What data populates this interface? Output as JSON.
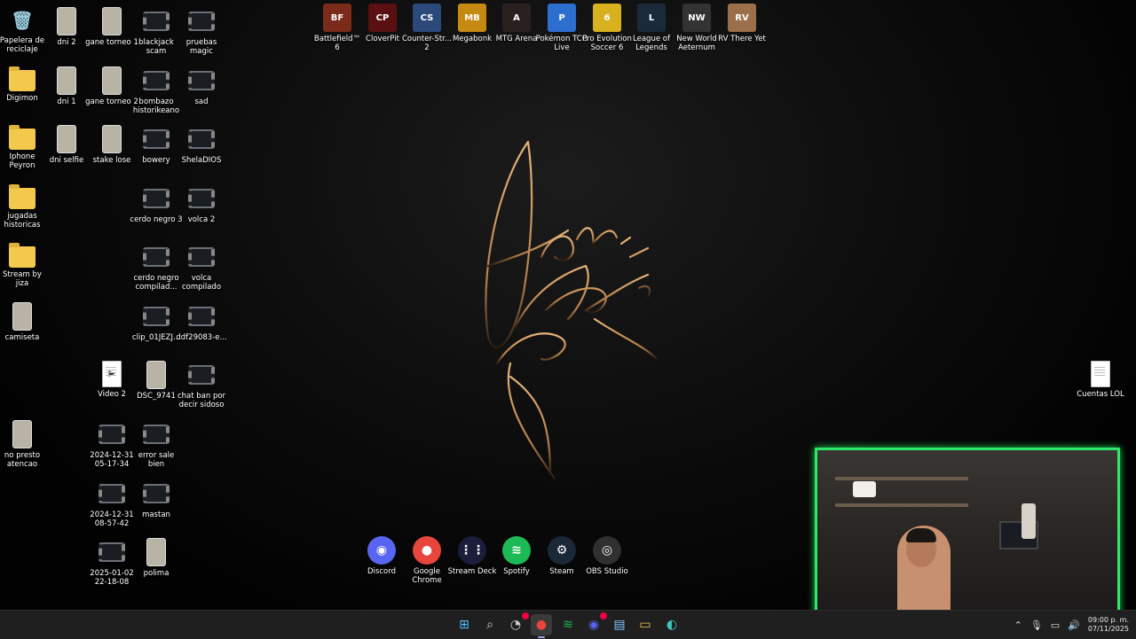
{
  "desktop": {
    "icons": [
      {
        "label": "Papelera de reciclaje",
        "icon": "recycle-bin-icon"
      },
      {
        "label": "dni 2",
        "icon": "photo-icon"
      },
      {
        "label": "gane torneo 1",
        "icon": "photo-icon"
      },
      {
        "label": "blackjack scam",
        "icon": "video-file-icon"
      },
      {
        "label": "pruebas magic",
        "icon": "video-file-icon"
      },
      {
        "label": "Digimon",
        "icon": "folder-icon"
      },
      {
        "label": "dni 1",
        "icon": "photo-icon"
      },
      {
        "label": "gane torneo 2",
        "icon": "photo-icon"
      },
      {
        "label": "bombazo historikeano",
        "icon": "video-file-icon"
      },
      {
        "label": "sad",
        "icon": "video-file-icon"
      },
      {
        "label": "Iphone Peyron",
        "icon": "folder-icon"
      },
      {
        "label": "dni selfie",
        "icon": "photo-icon"
      },
      {
        "label": "stake lose",
        "icon": "photo-icon"
      },
      {
        "label": "bowery",
        "icon": "video-file-icon"
      },
      {
        "label": "ShelaDIOS",
        "icon": "video-file-icon"
      },
      {
        "label": "jugadas historicas",
        "icon": "folder-icon"
      },
      {
        "label": "cerdo negro 3",
        "icon": "video-file-icon"
      },
      {
        "label": "volca 2",
        "icon": "video-file-icon"
      },
      {
        "label": "Stream by jiza",
        "icon": "folder-icon"
      },
      {
        "label": "cerdo negro compilad...",
        "icon": "video-file-icon"
      },
      {
        "label": "volca compilado",
        "icon": "video-file-icon"
      },
      {
        "label": "camiseta",
        "icon": "photo-icon"
      },
      {
        "label": "clip_01JEZJ...",
        "icon": "video-file-icon"
      },
      {
        "label": "ddf29083-e...",
        "icon": "video-file-icon"
      },
      {
        "label": "Video 2",
        "icon": "video-player-icon"
      },
      {
        "label": "DSC_9741",
        "icon": "photo-icon"
      },
      {
        "label": "chat ban por decir sidoso",
        "icon": "video-file-icon"
      },
      {
        "label": "no presto atencao",
        "icon": "photo-icon"
      },
      {
        "label": "2024-12-31 05-17-34",
        "icon": "video-file-icon"
      },
      {
        "label": "error sale bien",
        "icon": "video-file-icon"
      },
      {
        "label": "2024-12-31 08-57-42",
        "icon": "video-file-icon"
      },
      {
        "label": "mastan",
        "icon": "video-file-icon"
      },
      {
        "label": "2025-01-02 22-18-08",
        "icon": "video-file-icon"
      },
      {
        "label": "polima",
        "icon": "photo-icon"
      },
      {
        "label": "Cuentas LOL",
        "icon": "text-file-icon"
      }
    ],
    "apps": [
      {
        "label": "Battlefield™ 6",
        "color": "#7a2b1a",
        "glyph": "BF"
      },
      {
        "label": "CloverPit",
        "color": "#5a1010",
        "glyph": "CP"
      },
      {
        "label": "Counter-Str... 2",
        "color": "#2b4a7a",
        "glyph": "CS"
      },
      {
        "label": "Megabonk",
        "color": "#c68a12",
        "glyph": "MB"
      },
      {
        "label": "MTG Arena",
        "color": "#2a2020",
        "glyph": "A"
      },
      {
        "label": "Pokémon TCG Live",
        "color": "#2d6fcf",
        "glyph": "P"
      },
      {
        "label": "Pro Evolution Soccer 6",
        "color": "#d8b21e",
        "glyph": "6"
      },
      {
        "label": "League of Legends",
        "color": "#1a2a3a",
        "glyph": "L"
      },
      {
        "label": "New World Aeternum",
        "color": "#333",
        "glyph": "NW"
      },
      {
        "label": "RV There Yet",
        "color": "#9b6f4a",
        "glyph": "RV"
      }
    ],
    "dock": [
      {
        "label": "Discord",
        "color": "#5865f2",
        "glyph": "◉"
      },
      {
        "label": "Google Chrome",
        "color": "#e8453c",
        "glyph": "●"
      },
      {
        "label": "Stream Deck",
        "color": "#1b1e3a",
        "glyph": "⋮⋮"
      },
      {
        "label": "Spotify",
        "color": "#1db954",
        "glyph": "≋"
      },
      {
        "label": "Steam",
        "color": "#1b2838",
        "glyph": "⚙"
      },
      {
        "label": "OBS Studio",
        "color": "#303030",
        "glyph": "◎"
      }
    ]
  },
  "taskbar": {
    "clock_time": "09:00 p. m.",
    "clock_date": "07/11/2025"
  },
  "colors": {
    "webcam_border": "#2ee86a",
    "signature": "#d9a36a"
  }
}
